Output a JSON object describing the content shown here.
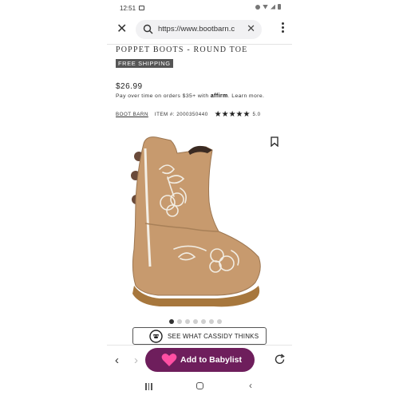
{
  "status_bar": {
    "time": "12:51",
    "icons": [
      "photo-icon",
      "alarm-icon",
      "wifi-icon",
      "signal-icon",
      "battery-icon"
    ]
  },
  "browser": {
    "url": "https://www.bootbarn.c",
    "icons": [
      "close-icon",
      "search-icon",
      "clear-icon",
      "more-icon"
    ]
  },
  "product": {
    "title": "POPPET BOOTS - ROUND TOE",
    "badge": "FREE SHIPPING",
    "price": "$26.99",
    "affirm_prefix": "Pay over time on orders $35+ with",
    "affirm_logo": "affirm",
    "affirm_suffix": ". Learn more.",
    "brand": "BOOT BARN",
    "item_label": "ITEM #: 2000350440",
    "stars": "★★★★★",
    "rating": "5.0",
    "image_count": 7,
    "active_image_index": 0
  },
  "cassidy": {
    "label": "SEE WHAT CASSIDY THINKS"
  },
  "bottom_bar": {
    "babylist_label": "Add to Babylist",
    "accent_color": "#6e1e5c",
    "heart_color": "#ff4fa3"
  }
}
